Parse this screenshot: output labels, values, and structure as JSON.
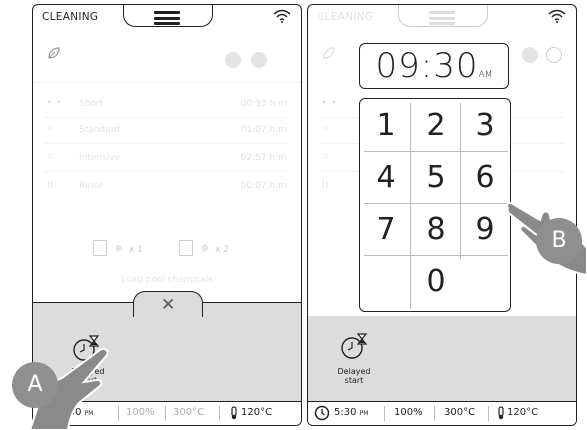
{
  "left_screen": {
    "status_label": "CLEANING",
    "programs": [
      {
        "name": "Short",
        "time": "00:33 h:m"
      },
      {
        "name": "Standard",
        "time": "01:07 h:m"
      },
      {
        "name": "Intensive",
        "time": "02:57 h:m"
      },
      {
        "name": "Rinse",
        "time": "00:07 h:m"
      }
    ],
    "tray_counts": [
      "x 1",
      "x 2"
    ],
    "detergent_text": "Load pool chemicals",
    "delayed_start_label": "Delayed start",
    "bottom_bar": {
      "time": "5:30",
      "time_suffix": "PM",
      "humidity": "100%",
      "cavity_temp": "300°C",
      "core_temp": "120°C"
    },
    "callout": "A"
  },
  "right_screen": {
    "status_label": "CLEANING",
    "time_display": "09:30",
    "time_suffix": "AM",
    "keys": [
      "1",
      "2",
      "3",
      "4",
      "5",
      "6",
      "7",
      "8",
      "9",
      "0"
    ],
    "delayed_start_label": "Delayed start",
    "bottom_bar": {
      "time": "5:30",
      "time_suffix": "PM",
      "humidity": "100%",
      "cavity_temp": "300°C",
      "core_temp": "120°C"
    },
    "callout": "B"
  },
  "colors": {
    "outline": "#222222",
    "gray_panel": "#dcdcdc",
    "callout": "#8f8f8f",
    "hand": "#8a8a8a"
  }
}
